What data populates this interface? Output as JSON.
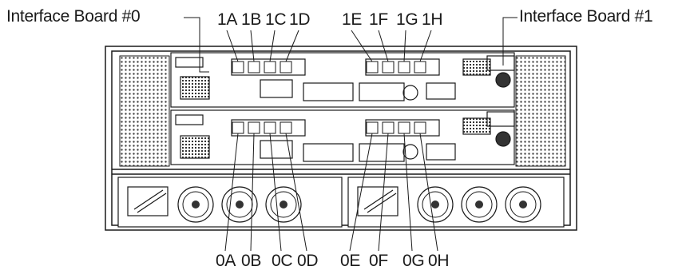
{
  "labels": {
    "board0": "Interface Board #0",
    "board1": "Interface Board #1"
  },
  "top_ports": [
    "1A",
    "1B",
    "1C",
    "1D",
    "1E",
    "1F",
    "1G",
    "1H"
  ],
  "bottom_ports": [
    "0A",
    "0B",
    "0C",
    "0D",
    "0E",
    "0F",
    "0G",
    "0H"
  ],
  "colors": {
    "line": "#1a1a1a",
    "background": "#ffffff",
    "vent": "#444444"
  }
}
